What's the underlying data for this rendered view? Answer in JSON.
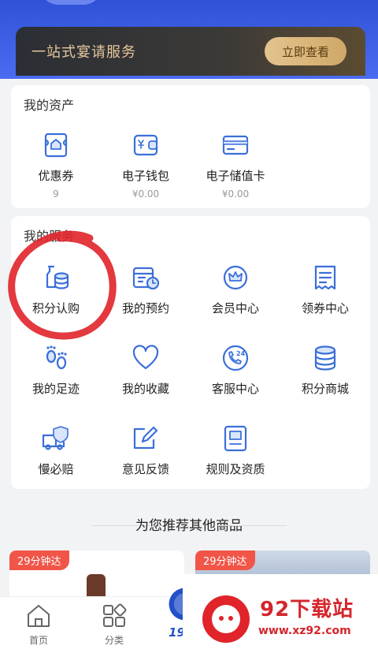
{
  "banner": {
    "title": "一站式宴请服务",
    "button": "立即查看"
  },
  "assets": {
    "title": "我的资产",
    "items": [
      {
        "label": "优惠券",
        "value": "9",
        "icon": "coupon-icon"
      },
      {
        "label": "电子钱包",
        "value": "¥0.00",
        "icon": "wallet-icon"
      },
      {
        "label": "电子储值卡",
        "value": "¥0.00",
        "icon": "card-icon"
      }
    ]
  },
  "services": {
    "title": "我的服务",
    "items": [
      {
        "label": "积分认购",
        "icon": "points-purchase-icon"
      },
      {
        "label": "我的预约",
        "icon": "reservation-icon"
      },
      {
        "label": "会员中心",
        "icon": "member-crown-icon"
      },
      {
        "label": "领券中心",
        "icon": "coupon-receipt-icon"
      },
      {
        "label": "我的足迹",
        "icon": "footprint-icon"
      },
      {
        "label": "我的收藏",
        "icon": "heart-icon"
      },
      {
        "label": "客服中心",
        "icon": "phone-24-icon"
      },
      {
        "label": "积分商城",
        "icon": "coin-stack-icon"
      },
      {
        "label": "慢必赔",
        "icon": "delivery-shield-icon"
      },
      {
        "label": "意见反馈",
        "icon": "edit-icon"
      },
      {
        "label": "规则及资质",
        "icon": "document-icon"
      }
    ]
  },
  "recommend": {
    "title": "为您推荐其他商品",
    "products": [
      {
        "tag": "29分钟达"
      },
      {
        "tag": "29分钟达"
      }
    ]
  },
  "tabbar": {
    "items": [
      {
        "label": "首页",
        "icon": "home-icon"
      },
      {
        "label": "分类",
        "icon": "category-icon"
      },
      {
        "label": "1919",
        "icon": "brand-logo-icon"
      }
    ]
  },
  "watermark": {
    "name": "92下载站",
    "url": "www.xz92.com"
  },
  "colors": {
    "accent": "#3b6fd9",
    "header": "#3a5de0",
    "tag": "#f05548",
    "annotation": "#e0242a"
  }
}
